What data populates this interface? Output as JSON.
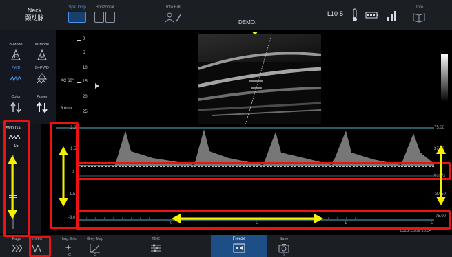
{
  "topbar": {
    "probe_line1": "Neck",
    "probe_line2": "颈动脉",
    "split_disp": "Split Disp",
    "horizontal": "Horizontal",
    "info_edit": "Info.Edit",
    "demo": "DEMO.",
    "probe_name": "L10-5",
    "info": "Info"
  },
  "modes": [
    {
      "label": "B-Mode",
      "icon": "b-mode-icon"
    },
    {
      "label": "M-Mode",
      "icon": "m-mode-icon"
    },
    {
      "label": "PWD",
      "icon": "pwd-wave-icon"
    },
    {
      "label": "B+PWD",
      "icon": "b-pwd-icon"
    },
    {
      "label": "Color",
      "icon": "color-arrows-icon"
    },
    {
      "label": "Power",
      "icon": "power-arrows-icon"
    }
  ],
  "imaging": {
    "ac_angle": "AC 60°",
    "depth": "3.0cm",
    "depth_ticks": [
      "0",
      "5",
      "10",
      "15",
      "20",
      "25"
    ]
  },
  "pwd": {
    "title": "PWD Gai",
    "value": "15",
    "gain_level": 0.5
  },
  "spectrum": {
    "vel_top_left": "3.0",
    "vel_15_left": "1.5",
    "vel_0_left": "0",
    "vel_n15_left": "-1.5",
    "vel_bottom_left": "-3.0",
    "vel_top_right": "75.00",
    "vel_mid_right": "37.50",
    "vel_base_right": "0cm/s",
    "vel_n_right": "-37.50",
    "vel_bottom_right": "-75.00",
    "time_ticks": [
      "0",
      "1",
      "2",
      "1",
      "2"
    ],
    "timestamp": "2023/11/09 10:54"
  },
  "bottombar": {
    "page": "Page",
    "invert": "Invert",
    "img_enh": "Img.Enh.",
    "img_enh_val": "C",
    "grey_map": "Grey Map",
    "grey_map_val": "C",
    "tgc": "TGC",
    "freeze": "Freeze",
    "save": "Save",
    "save_count": "1"
  },
  "colors": {
    "annotation_red": "#ee1111",
    "annotation_yellow": "#f5f000",
    "accent_blue": "#4a8fe8",
    "baseline_cyan": "#4fb5c6"
  }
}
